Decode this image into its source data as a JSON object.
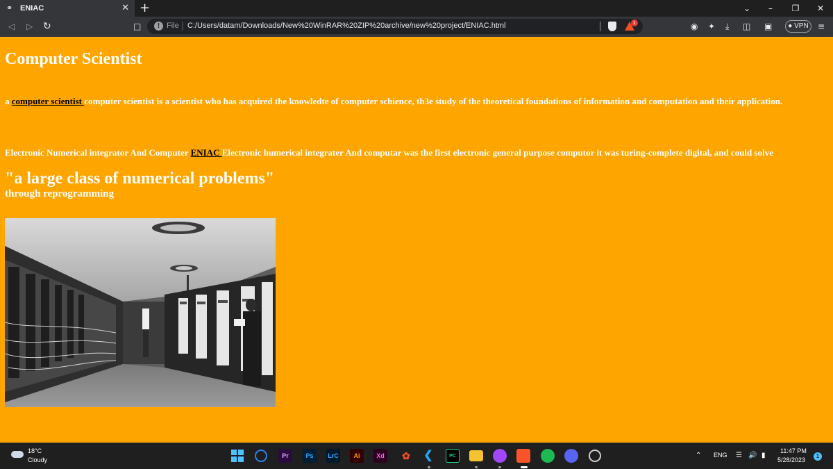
{
  "browser": {
    "tab_title": "ENIAC",
    "new_tab": "+",
    "url_scheme": "File",
    "url": "C:/Users/datam/Downloads/New%20WinRAR%20ZIP%20archive/new%20project/ENIAC.html",
    "vpn_label": "● VPN",
    "rewards_badge": "1"
  },
  "page": {
    "heading": "Computer Scientist",
    "p1_prefix": "a ",
    "p1_link": "computer scientist ",
    "p1_text": "computer scientist is a scientist who has acquired the knowledte of computer schience, th3e study of the theoretical foundations of information and computation and their application.",
    "p2_prefix": "Electronic Numerical integrator And Computer ",
    "p2_link": "ENIAC ",
    "p2_text": "Electronic humerical integrater And computar was the first electronic general purpose computor it was turing-complete digital, and could solve",
    "quote": "\"a large class of numerical problems\"",
    "through": "through reprogramming"
  },
  "taskbar": {
    "temperature": "18°C",
    "condition": "Cloudy",
    "apps": [
      "Pr",
      "Ps",
      "LrC",
      "Ai",
      "Xd"
    ],
    "language": "ENG",
    "time": "11:47 PM",
    "date": "5/28/2023",
    "notifications": "1"
  },
  "colors": {
    "page_background": "#ffa500",
    "text": "#ffffff",
    "link": "#000000"
  }
}
